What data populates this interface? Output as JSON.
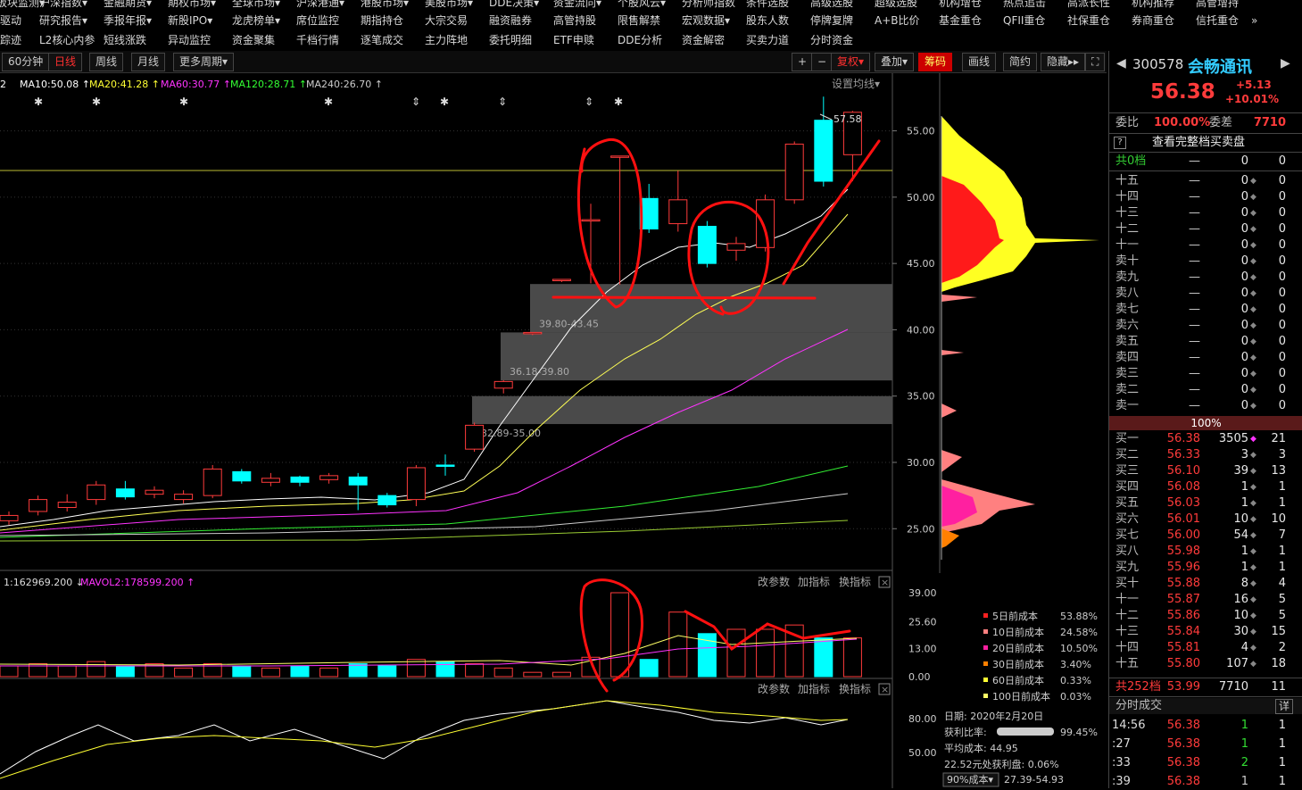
{
  "menu": {
    "row1": [
      "板块监测▾",
      "沪深指数▾",
      "金融期货▾",
      "期权市场▾",
      "全球市场▾",
      "沪深港通▾",
      "港股市场▾",
      "美股市场▾",
      "DDE决策▾",
      "资金流向▾",
      "个股风云▾",
      "分析师指数",
      "条件选股",
      "高级选股",
      "超级选股",
      "机构增仓",
      "热点追击",
      "高派长性",
      "机构推荐",
      "高管增持"
    ],
    "row2": [
      "驱动",
      "研究报告▾",
      "季报年报▾",
      "新股IPO▾",
      "龙虎榜单▾",
      "席位监控",
      "期指持仓",
      "大宗交易",
      "融资融券",
      "高管持股",
      "限售解禁",
      "宏观数据▾",
      "股东人数",
      "停牌复牌",
      "A+B比价",
      "基金重仓",
      "QFII重仓",
      "社保重仓",
      "券商重仓",
      "信托重仓",
      "»"
    ],
    "row3": [
      "踪迹",
      "L2核心内参",
      "短线涨跌",
      "异动监控",
      "资金聚集",
      "千档行情",
      "逐笔成交",
      "主力阵地",
      "委托明细",
      "ETF申赎",
      "DDE分析",
      "资金解密",
      "买卖力道",
      "分时资金"
    ]
  },
  "toolbar": {
    "periods": [
      "60分钟",
      "日线",
      "周线",
      "月线",
      "更多周期▾"
    ],
    "active_period": "日线",
    "right_buttons": [
      "+",
      "−",
      "复权▾",
      "叠加▾",
      "筹码",
      "画线",
      "简约",
      "隐藏▸▸"
    ]
  },
  "ma_legend": [
    {
      "text": "2",
      "color": "#ffffff"
    },
    {
      "text": "MA10:50.08 ↑",
      "color": "#ffffff"
    },
    {
      "text": "MA20:41.28 ↑",
      "color": "#ffff33"
    },
    {
      "text": "MA60:30.77 ↑",
      "color": "#ff33ff"
    },
    {
      "text": "MA120:28.71 ↑",
      "color": "#33ff33"
    },
    {
      "text": "MA240:26.70 ↑",
      "color": "#cccccc"
    }
  ],
  "ma_setting": "设置均线▾",
  "price_axis": [
    "55.00",
    "50.00",
    "45.00",
    "40.00",
    "35.00",
    "30.00",
    "25.00"
  ],
  "high_label": "57.58",
  "zones": [
    {
      "label": "39.80-43.45"
    },
    {
      "label": "36.18-39.80"
    },
    {
      "label": "32.89-35.00"
    }
  ],
  "vol_legend": {
    "a": "1:162969.200 ↓",
    "b": "MAVOL2:178599.200 ↑"
  },
  "vol_axis": [
    "39.00",
    "25.60",
    "13.00",
    "0.00"
  ],
  "panel_buttons": [
    "改参数",
    "加指标",
    "换指标"
  ],
  "ind_axis": [
    "80.00",
    "50.00"
  ],
  "cost_legend": [
    {
      "label": "5日前成本",
      "value": "53.88%",
      "color": "#ff2020"
    },
    {
      "label": "10日前成本",
      "value": "24.58%",
      "color": "#ff8080"
    },
    {
      "label": "20日前成本",
      "value": "10.50%",
      "color": "#ff20a0"
    },
    {
      "label": "30日前成本",
      "value": "3.40%",
      "color": "#ff8000"
    },
    {
      "label": "60日前成本",
      "value": "0.33%",
      "color": "#ffff33"
    },
    {
      "label": "100日前成本",
      "value": "0.03%",
      "color": "#ffff66"
    }
  ],
  "chip_info": {
    "date": "日期: 2020年2月20日",
    "profit_label": "获利比率:",
    "profit_value": "99.45%",
    "avg_cost": "平均成本: 44.95",
    "profit_at": "22.52元处获利盘: 0.06%",
    "cost_select": "90%成本▾",
    "cost_range": "27.39-54.93"
  },
  "quote": {
    "code": "300578",
    "name": "会畅通讯",
    "price": "56.38",
    "change": "+5.13",
    "pct": "+10.01%",
    "weibi_label": "委比",
    "weibi_value": "100.00%",
    "weicha_label": "委差",
    "weicha_value": "7710",
    "full_depth": "查看完整档买卖盘",
    "sell_total": {
      "label": "共0档",
      "price": "—",
      "vol": "0",
      "cnt": "0"
    },
    "sells": [
      {
        "label": "十五",
        "price": "—",
        "vol": "0",
        "cnt": "0"
      },
      {
        "label": "十四",
        "price": "—",
        "vol": "0",
        "cnt": "0"
      },
      {
        "label": "十三",
        "price": "—",
        "vol": "0",
        "cnt": "0"
      },
      {
        "label": "十二",
        "price": "—",
        "vol": "0",
        "cnt": "0"
      },
      {
        "label": "十一",
        "price": "—",
        "vol": "0",
        "cnt": "0"
      },
      {
        "label": "卖十",
        "price": "—",
        "vol": "0",
        "cnt": "0"
      },
      {
        "label": "卖九",
        "price": "—",
        "vol": "0",
        "cnt": "0"
      },
      {
        "label": "卖八",
        "price": "—",
        "vol": "0",
        "cnt": "0"
      },
      {
        "label": "卖七",
        "price": "—",
        "vol": "0",
        "cnt": "0"
      },
      {
        "label": "卖六",
        "price": "—",
        "vol": "0",
        "cnt": "0"
      },
      {
        "label": "卖五",
        "price": "—",
        "vol": "0",
        "cnt": "0"
      },
      {
        "label": "卖四",
        "price": "—",
        "vol": "0",
        "cnt": "0"
      },
      {
        "label": "卖三",
        "price": "—",
        "vol": "0",
        "cnt": "0"
      },
      {
        "label": "卖二",
        "price": "—",
        "vol": "0",
        "cnt": "0"
      },
      {
        "label": "卖一",
        "price": "—",
        "vol": "0",
        "cnt": "0"
      }
    ],
    "ratio_bar": "100%",
    "buys": [
      {
        "label": "买一",
        "price": "56.38",
        "vol": "3505",
        "cnt": "21"
      },
      {
        "label": "买二",
        "price": "56.33",
        "vol": "3",
        "cnt": "3"
      },
      {
        "label": "买三",
        "price": "56.10",
        "vol": "39",
        "cnt": "13"
      },
      {
        "label": "买四",
        "price": "56.08",
        "vol": "1",
        "cnt": "1"
      },
      {
        "label": "买五",
        "price": "56.03",
        "vol": "1",
        "cnt": "1"
      },
      {
        "label": "买六",
        "price": "56.01",
        "vol": "10",
        "cnt": "10"
      },
      {
        "label": "买七",
        "price": "56.00",
        "vol": "54",
        "cnt": "7"
      },
      {
        "label": "买八",
        "price": "55.98",
        "vol": "1",
        "cnt": "1"
      },
      {
        "label": "买九",
        "price": "55.96",
        "vol": "1",
        "cnt": "1"
      },
      {
        "label": "买十",
        "price": "55.88",
        "vol": "8",
        "cnt": "4"
      },
      {
        "label": "十一",
        "price": "55.87",
        "vol": "16",
        "cnt": "5"
      },
      {
        "label": "十二",
        "price": "55.86",
        "vol": "10",
        "cnt": "5"
      },
      {
        "label": "十三",
        "price": "55.84",
        "vol": "30",
        "cnt": "15"
      },
      {
        "label": "十四",
        "price": "55.81",
        "vol": "4",
        "cnt": "2"
      },
      {
        "label": "十五",
        "price": "55.80",
        "vol": "107",
        "cnt": "18"
      }
    ],
    "buy_total": {
      "label": "共252档",
      "price": "53.99",
      "vol": "7710",
      "cnt": "11"
    },
    "ticks_title": "分时成交",
    "ticks_detail": "详",
    "ticks": [
      {
        "time": "14:56",
        "price": "56.38",
        "vol": "1",
        "cnt": "1"
      },
      {
        "time": ":27",
        "price": "56.38",
        "vol": "1",
        "cnt": "1"
      },
      {
        "time": ":33",
        "price": "56.38",
        "vol": "2",
        "cnt": "1"
      },
      {
        "time": ":39",
        "price": "56.38",
        "vol": "1",
        "cnt": "1"
      }
    ]
  },
  "chart_data": {
    "type": "candlestick",
    "y_range": [
      23,
      58
    ],
    "candles": [
      {
        "o": 25.6,
        "c": 26.0,
        "h": 26.3,
        "l": 25.3
      },
      {
        "o": 26.3,
        "c": 27.2,
        "h": 27.5,
        "l": 26.0
      },
      {
        "o": 26.6,
        "c": 27.0,
        "h": 27.6,
        "l": 26.3
      },
      {
        "o": 27.2,
        "c": 28.3,
        "h": 28.6,
        "l": 26.8
      },
      {
        "o": 28.0,
        "c": 27.4,
        "h": 28.6,
        "l": 27.2
      },
      {
        "o": 27.6,
        "c": 27.9,
        "h": 28.2,
        "l": 27.3
      },
      {
        "o": 27.2,
        "c": 27.6,
        "h": 27.9,
        "l": 26.9
      },
      {
        "o": 27.5,
        "c": 29.5,
        "h": 29.8,
        "l": 27.3
      },
      {
        "o": 29.3,
        "c": 28.6,
        "h": 29.5,
        "l": 28.4
      },
      {
        "o": 28.5,
        "c": 28.8,
        "h": 29.2,
        "l": 28.2
      },
      {
        "o": 28.9,
        "c": 28.5,
        "h": 29.0,
        "l": 28.2
      },
      {
        "o": 28.7,
        "c": 29.0,
        "h": 29.2,
        "l": 28.4
      },
      {
        "o": 28.9,
        "c": 28.3,
        "h": 29.2,
        "l": 26.4
      },
      {
        "o": 27.5,
        "c": 26.8,
        "h": 27.7,
        "l": 26.6
      },
      {
        "o": 27.2,
        "c": 29.6,
        "h": 29.8,
        "l": 26.7
      },
      {
        "o": 29.8,
        "c": 29.7,
        "h": 30.6,
        "l": 29.0
      },
      {
        "o": 31.0,
        "c": 32.8,
        "h": 33.0,
        "l": 30.8
      },
      {
        "o": 35.6,
        "c": 36.1,
        "h": 36.2,
        "l": 35.2
      },
      {
        "o": 39.7,
        "c": 39.8,
        "h": 39.8,
        "l": 39.6
      },
      {
        "o": 43.7,
        "c": 43.8,
        "h": 43.8,
        "l": 43.6
      },
      {
        "o": 48.2,
        "c": 48.3,
        "h": 49.5,
        "l": 43.5
      },
      {
        "o": 53.0,
        "c": 53.1,
        "h": 53.1,
        "l": 43.4
      },
      {
        "o": 49.9,
        "c": 47.6,
        "h": 51.0,
        "l": 47.3
      },
      {
        "o": 48.0,
        "c": 49.8,
        "h": 52.0,
        "l": 47.4
      },
      {
        "o": 47.8,
        "c": 45.0,
        "h": 48.2,
        "l": 44.7
      },
      {
        "o": 46.0,
        "c": 46.5,
        "h": 47.0,
        "l": 45.2
      },
      {
        "o": 46.2,
        "c": 49.8,
        "h": 50.2,
        "l": 45.9
      },
      {
        "o": 49.8,
        "c": 54.0,
        "h": 54.2,
        "l": 49.5
      },
      {
        "o": 55.8,
        "c": 51.2,
        "h": 57.58,
        "l": 50.8
      },
      {
        "o": 53.2,
        "c": 56.4,
        "h": 56.5,
        "l": 51.2
      }
    ],
    "volumes": [
      5,
      6,
      5,
      7,
      5,
      6,
      4,
      6,
      5,
      4,
      5,
      4,
      6,
      5,
      8,
      7,
      6,
      4,
      2,
      2,
      9,
      39,
      8,
      30,
      20,
      22,
      22,
      24,
      18,
      18
    ]
  }
}
